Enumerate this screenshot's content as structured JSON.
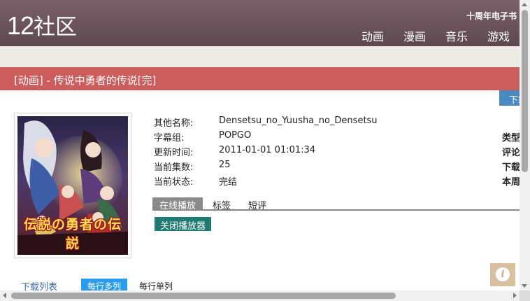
{
  "header": {
    "logo_number": "12",
    "logo_text": "社区",
    "tagline": "十周年电子书",
    "nav": [
      {
        "label": "动画"
      },
      {
        "label": "漫画"
      },
      {
        "label": "音乐"
      },
      {
        "label": "游戏"
      }
    ]
  },
  "page_title": "[动画] - 传说中勇者的传说[完]",
  "download_button": "下载",
  "cover": {
    "title_art": "伝説の勇者の伝説"
  },
  "info": [
    {
      "label": "其他名称:",
      "value": "Densetsu_no_Yuusha_no_Densetsu"
    },
    {
      "label": "字幕组:",
      "value": "POPGO"
    },
    {
      "label": "更新时间:",
      "value": "2011-01-01 01:01:34"
    },
    {
      "label": "当前集数:",
      "value": "25"
    },
    {
      "label": "当前状态:",
      "value": "完结"
    }
  ],
  "right_info": [
    "类型",
    "评论",
    "下载",
    "本周"
  ],
  "tabs": [
    {
      "label": "在线播放",
      "active": true
    },
    {
      "label": "标签",
      "active": false
    },
    {
      "label": "短评",
      "active": false
    }
  ],
  "close_player_button": "关闭播放器",
  "list": {
    "download_list": "下载列表",
    "mode_multi": "每行多列",
    "mode_single": "每行单列"
  },
  "colors": {
    "header": "#6b5259",
    "title_bar": "#cd5c5c",
    "download_button": "#4a8ac0",
    "close_player": "#1f7a72",
    "mode_active": "#2a9cf0"
  }
}
